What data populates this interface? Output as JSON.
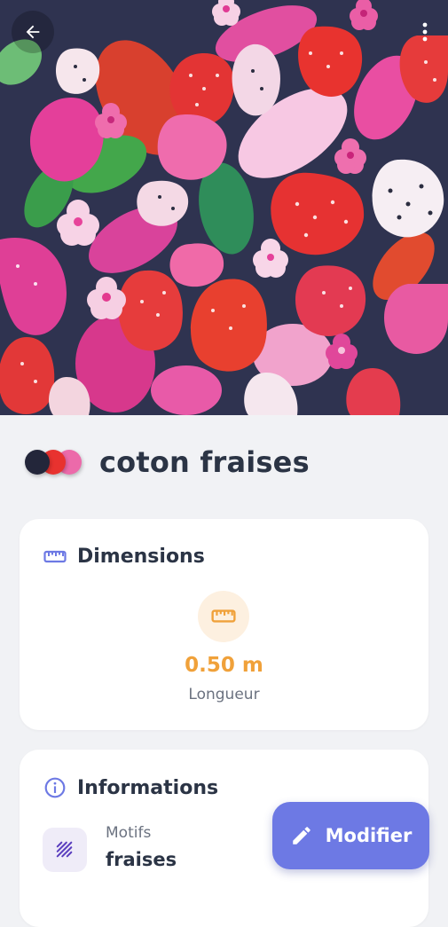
{
  "header": {
    "back_icon": "arrow-left-icon",
    "menu_icon": "more-vertical-icon"
  },
  "fabric": {
    "name": "coton fraises",
    "colors": [
      "#23263a",
      "#e8322f",
      "#ec6aaa"
    ]
  },
  "dimensions": {
    "title": "Dimensions",
    "icon": "ruler-icon",
    "length_value": "0.50 m",
    "length_label": "Longueur"
  },
  "informations": {
    "title": "Informations",
    "icon": "info-circle-icon",
    "motif_label": "Motifs",
    "motif_value": "fraises",
    "motif_icon": "pattern-icon"
  },
  "fab": {
    "label": "Modifier",
    "icon": "pencil-icon"
  },
  "colors": {
    "background": "#f1f2f5",
    "accent": "#6d79e4",
    "length_accent": "#f0a13a",
    "title_text": "#2b3445"
  }
}
